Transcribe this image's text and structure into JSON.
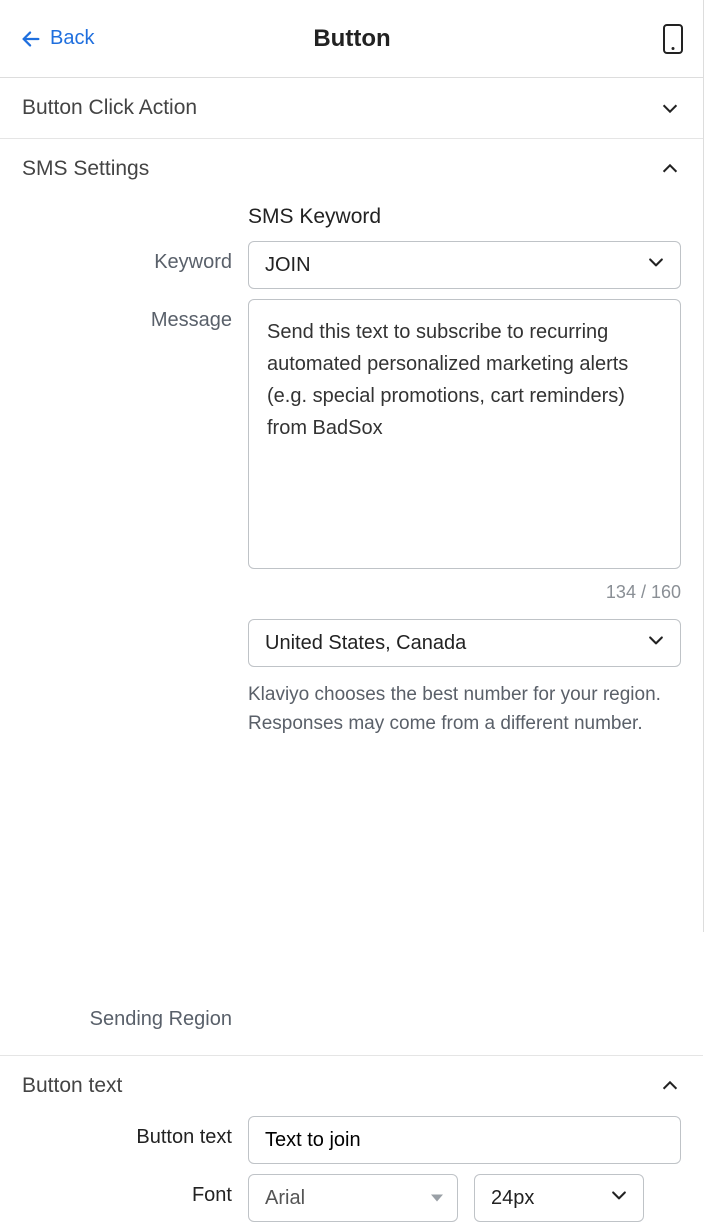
{
  "header": {
    "back_label": "Back",
    "title": "Button"
  },
  "sections": {
    "button_click": {
      "title": "Button Click Action",
      "expanded": false
    },
    "sms_settings": {
      "title": "SMS Settings",
      "expanded": true,
      "subhead": "SMS Keyword",
      "keyword_label": "Keyword",
      "keyword_value": "JOIN",
      "message_label": "Message",
      "message_value": "Send this text to subscribe to recurring automated personalized marketing alerts (e.g. special promotions, cart reminders) from BadSox",
      "char_count": "134 / 160",
      "region_label": "Sending Region",
      "region_value": "United States, Canada",
      "region_help": "Klaviyo chooses the best number for your region. Responses may come from a different number."
    },
    "button_text": {
      "title": "Button text",
      "expanded": true,
      "text_label": "Button text",
      "text_value": "Text to join",
      "font_label": "Font",
      "font_value": "Arial",
      "size_value": "24px"
    }
  }
}
